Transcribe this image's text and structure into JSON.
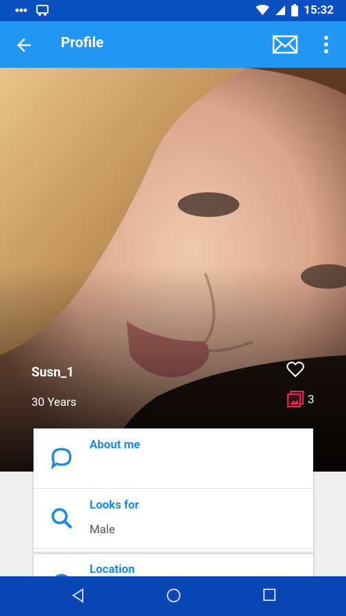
{
  "status_bar": {
    "time": "15:32"
  },
  "app_bar": {
    "title": "Profile"
  },
  "profile": {
    "name": "Susn_1",
    "age": "30 Years",
    "photo_count": "3"
  },
  "details": [
    {
      "label": "About me",
      "value": ""
    },
    {
      "label": "Looks for",
      "value": "Male"
    },
    {
      "label": "Location",
      "value": ""
    }
  ],
  "colors": {
    "status_bar": "#0a50c0",
    "app_bar": "#2196f3",
    "accent": "#1e88e5",
    "photo_icon": "#e8285c",
    "nav_bar": "#0a46b4"
  },
  "icons": [
    "back-arrow-icon",
    "mail-icon",
    "more-vert-icon",
    "heart-icon",
    "photos-icon",
    "chat-bubble-icon",
    "search-icon",
    "location-icon"
  ]
}
